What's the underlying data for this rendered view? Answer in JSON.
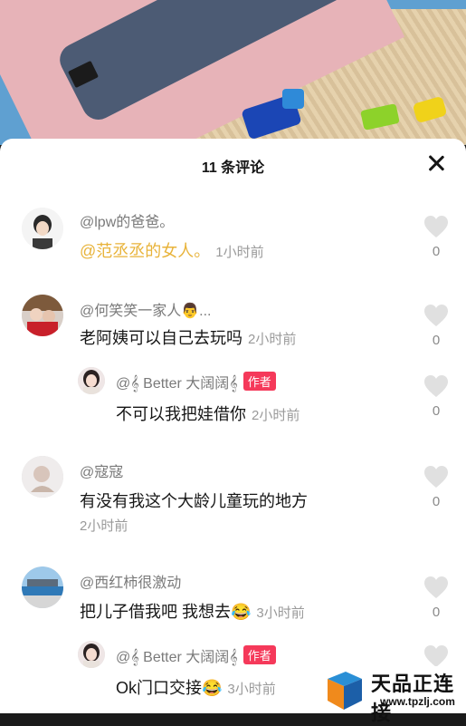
{
  "header": {
    "title": "11 条评论"
  },
  "comments": [
    {
      "name": "@lpw的爸爸。",
      "text": "@范丞丞的女人。",
      "time": "1小时前",
      "likes": "0"
    },
    {
      "name": "@何笑笑一家人👨...",
      "text": "老阿姨可以自己去玩吗",
      "time": "2小时前",
      "likes": "0",
      "reply": {
        "name": "@𝄞 Better 大阔阔𝄞",
        "badge": "作者",
        "text": "不可以我把娃借你",
        "time": "2小时前",
        "likes": "0"
      }
    },
    {
      "name": "@寇寇",
      "text": "有没有我这个大龄儿童玩的地方",
      "time": "2小时前",
      "likes": "0"
    },
    {
      "name": "@西红柿很激动",
      "text": "把儿子借我吧 我想去😂",
      "time": "3小时前",
      "likes": "0",
      "reply": {
        "name": "@𝄞 Better 大阔阔𝄞",
        "badge": "作者",
        "text": "Ok门口交接😂",
        "time": "3小时前"
      }
    }
  ],
  "watermark": {
    "text": "天品正连接",
    "url": "www.tpzlj.com"
  },
  "colors": {
    "mention": "#e8b33a",
    "author_badge": "#f5395a",
    "heart": "#e0e0e0"
  },
  "icons": {
    "close": "close-icon",
    "like": "heart-icon"
  }
}
